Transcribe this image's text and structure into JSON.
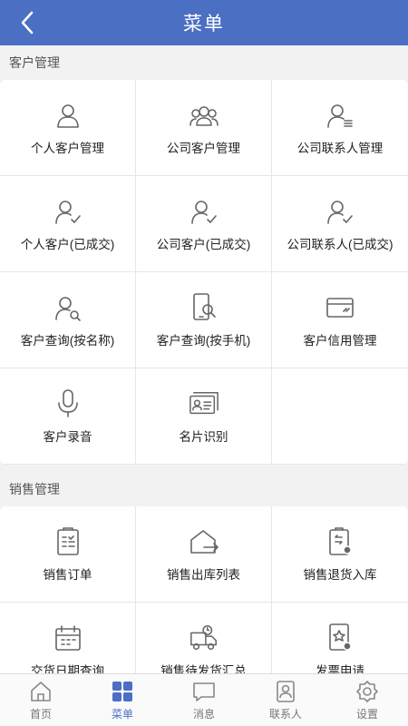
{
  "header": {
    "title": "菜单"
  },
  "sections": [
    {
      "title": "客户管理",
      "items": [
        {
          "label": "个人客户管理",
          "icon": "person-icon"
        },
        {
          "label": "公司客户管理",
          "icon": "group-icon"
        },
        {
          "label": "公司联系人管理",
          "icon": "contact-list-icon"
        },
        {
          "label": "个人客户(已成交)",
          "icon": "person-check-icon"
        },
        {
          "label": "公司客户(已成交)",
          "icon": "person-check-icon"
        },
        {
          "label": "公司联系人(已成交)",
          "icon": "person-check-icon"
        },
        {
          "label": "客户查询(按名称)",
          "icon": "person-search-icon"
        },
        {
          "label": "客户查询(按手机)",
          "icon": "phone-search-icon"
        },
        {
          "label": "客户信用管理",
          "icon": "credit-card-icon"
        },
        {
          "label": "客户录音",
          "icon": "microphone-icon"
        },
        {
          "label": "名片识别",
          "icon": "business-card-icon"
        }
      ]
    },
    {
      "title": "销售管理",
      "items": [
        {
          "label": "销售订单",
          "icon": "order-clipboard-icon"
        },
        {
          "label": "销售出库列表",
          "icon": "warehouse-out-icon"
        },
        {
          "label": "销售退货入库",
          "icon": "return-clipboard-icon"
        },
        {
          "label": "交货日期查询",
          "icon": "calendar-icon"
        },
        {
          "label": "销售待发货汇总",
          "icon": "truck-clock-icon"
        },
        {
          "label": "发票申请",
          "icon": "invoice-icon"
        }
      ]
    }
  ],
  "tabbar": [
    {
      "label": "首页",
      "icon": "home-icon"
    },
    {
      "label": "菜单",
      "icon": "menu-grid-icon",
      "active": true
    },
    {
      "label": "消息",
      "icon": "message-icon"
    },
    {
      "label": "联系人",
      "icon": "contacts-icon"
    },
    {
      "label": "设置",
      "icon": "settings-icon"
    }
  ],
  "colors": {
    "primary": "#4a6fc3",
    "icon": "#666666",
    "text": "#222222"
  }
}
